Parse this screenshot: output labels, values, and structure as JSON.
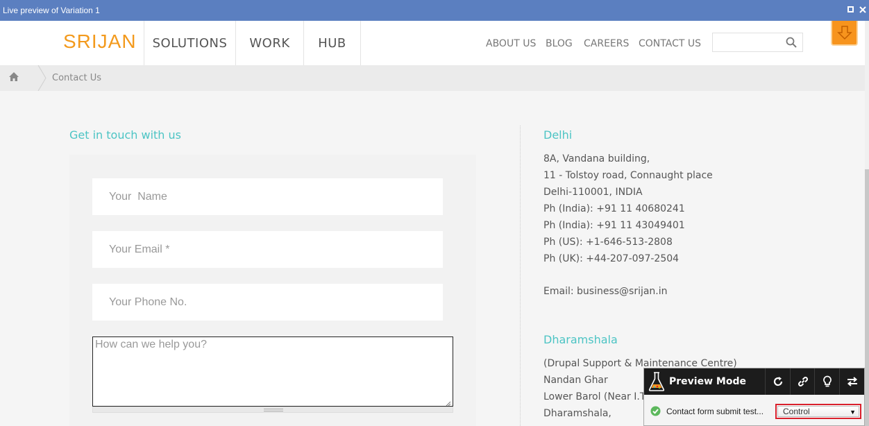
{
  "window": {
    "title": "Live preview of Variation 1"
  },
  "header": {
    "logo": "SRIJAN",
    "main_nav": [
      "SOLUTIONS",
      "WORK",
      "HUB"
    ],
    "secondary_nav": [
      "ABOUT US",
      "BLOG",
      "CAREERS",
      "CONTACT US"
    ],
    "search": {
      "value": "",
      "placeholder": ""
    }
  },
  "breadcrumb": {
    "current": "Contact Us"
  },
  "form": {
    "heading": "Get in touch with us",
    "name_placeholder": "Your  Name",
    "email_placeholder": "Your Email *",
    "phone_placeholder": "Your Phone No.",
    "message_placeholder": "How can we help you?"
  },
  "offices": {
    "delhi": {
      "city": "Delhi",
      "lines": [
        "8A, Vandana building,",
        "11 - Tolstoy road, Connaught place",
        "Delhi-110001, INDIA",
        "Ph (India): +91 11 40680241",
        "Ph (India): +91 11 43049401",
        "Ph (US): +1-646-513-2808",
        "Ph (UK): +44-207-097-2504"
      ],
      "email": "Email: business@srijan.in"
    },
    "dharamshala": {
      "city": "Dharamshala",
      "lines": [
        "(Drupal Support & Maintenance Centre)",
        "Nandan Ghar",
        "Lower Barol (Near I.T.I.)",
        "Dharamshala,"
      ]
    }
  },
  "preview": {
    "title": "Preview Mode",
    "test_name": "Contact form submit test...",
    "variation_selected": "Control"
  },
  "colors": {
    "accent": "#4cc4c4",
    "brand": "#f39a1d",
    "titlebar": "#5b7fc0",
    "highlight": "#d9202c"
  }
}
